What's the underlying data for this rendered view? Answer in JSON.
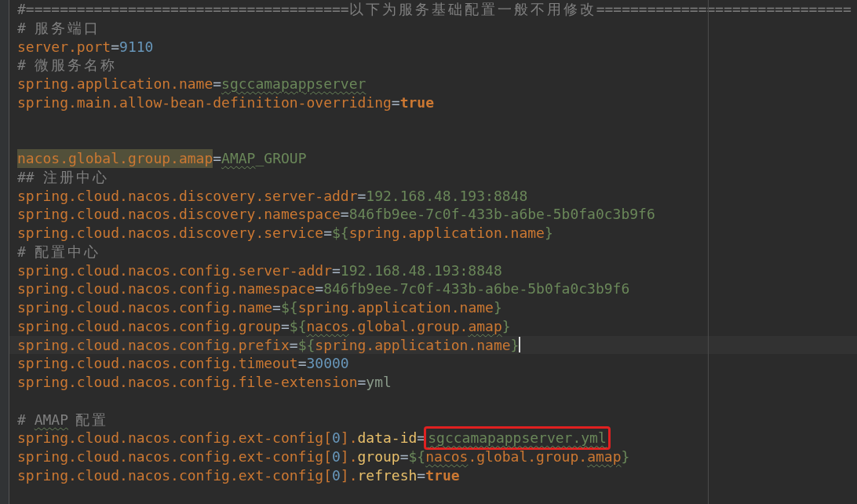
{
  "editor": {
    "lines": [
      {
        "kind": "code",
        "current": false,
        "segments": [
          {
            "text": "#======================================",
            "kind": "comment"
          },
          {
            "text": "以下为服务基础配置一般不用修改",
            "kind": "comment-cn"
          },
          {
            "text": "==============================",
            "kind": "comment"
          }
        ]
      },
      {
        "kind": "code",
        "current": false,
        "segments": [
          {
            "text": "# ",
            "kind": "comment"
          },
          {
            "text": "服务端口",
            "kind": "comment-cn"
          }
        ]
      },
      {
        "kind": "code",
        "current": false,
        "segments": [
          {
            "text": "server.port",
            "kind": "key"
          },
          {
            "text": "=",
            "kind": "sep"
          },
          {
            "text": "9110",
            "kind": "number"
          }
        ]
      },
      {
        "kind": "code",
        "current": false,
        "segments": [
          {
            "text": "# ",
            "kind": "comment"
          },
          {
            "text": "微服务名称",
            "kind": "comment-cn"
          }
        ]
      },
      {
        "kind": "code",
        "current": false,
        "segments": [
          {
            "text": "spring.application.name",
            "kind": "key"
          },
          {
            "text": "=",
            "kind": "sep"
          },
          {
            "text": "sgccamapappserver",
            "kind": "string-typo"
          }
        ]
      },
      {
        "kind": "code",
        "current": false,
        "segments": [
          {
            "text": "spring.main.allow-bean-definition-overriding",
            "kind": "key"
          },
          {
            "text": "=",
            "kind": "sep"
          },
          {
            "text": "true",
            "kind": "bool"
          }
        ]
      },
      {
        "kind": "blank"
      },
      {
        "kind": "blank"
      },
      {
        "kind": "code",
        "current": false,
        "segments": [
          {
            "text": "nacos.global.group.amap",
            "kind": "key-found"
          },
          {
            "text": "=",
            "kind": "sep"
          },
          {
            "text": "AMAP",
            "kind": "string-typo"
          },
          {
            "text": "_GROUP",
            "kind": "string"
          }
        ]
      },
      {
        "kind": "code",
        "current": false,
        "segments": [
          {
            "text": "## ",
            "kind": "comment"
          },
          {
            "text": "注册中心",
            "kind": "comment-cn"
          }
        ]
      },
      {
        "kind": "code",
        "current": false,
        "segments": [
          {
            "text": "spring.cloud.nacos.discovery.server-addr",
            "kind": "key"
          },
          {
            "text": "=",
            "kind": "sep"
          },
          {
            "text": "192.168.48.193:8848",
            "kind": "string"
          }
        ]
      },
      {
        "kind": "code",
        "current": false,
        "segments": [
          {
            "text": "spring.cloud.nacos.discovery.namespace",
            "kind": "key"
          },
          {
            "text": "=",
            "kind": "sep"
          },
          {
            "text": "846fb9ee-7c0f-433b-a6be-5b0fa0c3b9f6",
            "kind": "string"
          }
        ]
      },
      {
        "kind": "code",
        "current": false,
        "segments": [
          {
            "text": "spring.cloud.nacos.discovery.service",
            "kind": "key"
          },
          {
            "text": "=",
            "kind": "sep"
          },
          {
            "text": "${",
            "kind": "brace"
          },
          {
            "text": "spring.application.name",
            "kind": "ref"
          },
          {
            "text": "}",
            "kind": "brace"
          }
        ]
      },
      {
        "kind": "code",
        "current": false,
        "segments": [
          {
            "text": "# ",
            "kind": "comment"
          },
          {
            "text": "配置中心",
            "kind": "comment-cn"
          }
        ]
      },
      {
        "kind": "code",
        "current": false,
        "segments": [
          {
            "text": "spring.cloud.nacos.config.server-addr",
            "kind": "key"
          },
          {
            "text": "=",
            "kind": "sep"
          },
          {
            "text": "192.168.48.193:8848",
            "kind": "string"
          }
        ]
      },
      {
        "kind": "code",
        "current": false,
        "segments": [
          {
            "text": "spring.cloud.nacos.config.namespace",
            "kind": "key"
          },
          {
            "text": "=",
            "kind": "sep"
          },
          {
            "text": "846fb9ee-7c0f-433b-a6be-5b0fa0c3b9f6",
            "kind": "string"
          }
        ]
      },
      {
        "kind": "code",
        "current": false,
        "segments": [
          {
            "text": "spring.cloud.nacos.config.name",
            "kind": "key"
          },
          {
            "text": "=",
            "kind": "sep"
          },
          {
            "text": "${",
            "kind": "brace"
          },
          {
            "text": "spring.application.name",
            "kind": "ref"
          },
          {
            "text": "}",
            "kind": "brace"
          }
        ]
      },
      {
        "kind": "code",
        "current": false,
        "segments": [
          {
            "text": "spring.cloud.nacos.config.group",
            "kind": "key"
          },
          {
            "text": "=",
            "kind": "sep"
          },
          {
            "text": "${",
            "kind": "brace"
          },
          {
            "text": "nacos",
            "kind": "ref-typo"
          },
          {
            "text": ".global.group.",
            "kind": "ref"
          },
          {
            "text": "amap",
            "kind": "ref-typo"
          },
          {
            "text": "}",
            "kind": "brace"
          }
        ]
      },
      {
        "kind": "code",
        "current": true,
        "segments": [
          {
            "text": "spring.cloud.nacos.config.prefix",
            "kind": "key"
          },
          {
            "text": "=",
            "kind": "sep"
          },
          {
            "text": "${",
            "kind": "brace"
          },
          {
            "text": "spring.application.name",
            "kind": "ref"
          },
          {
            "text": "}",
            "kind": "brace"
          }
        ]
      },
      {
        "kind": "code",
        "current": false,
        "segments": [
          {
            "text": "spring.cloud.nacos.config.timeout",
            "kind": "key"
          },
          {
            "text": "=",
            "kind": "sep"
          },
          {
            "text": "30000",
            "kind": "number"
          }
        ]
      },
      {
        "kind": "code",
        "current": false,
        "segments": [
          {
            "text": "spring.cloud.nacos.config.file-extension",
            "kind": "key"
          },
          {
            "text": "=",
            "kind": "sep"
          },
          {
            "text": "yml",
            "kind": "plain"
          }
        ]
      },
      {
        "kind": "blank"
      },
      {
        "kind": "code",
        "current": false,
        "segments": [
          {
            "text": "# ",
            "kind": "comment"
          },
          {
            "text": "AMAP",
            "kind": "comment-typo"
          },
          {
            "text": " 配置",
            "kind": "comment-cn"
          }
        ]
      },
      {
        "kind": "code",
        "current": false,
        "segments": [
          {
            "text": "spring.cloud.nacos.config.ext-config[",
            "kind": "key"
          },
          {
            "text": "0",
            "kind": "index"
          },
          {
            "text": "].",
            "kind": "key"
          },
          {
            "text": "data-id",
            "kind": "key-sub"
          },
          {
            "text": "=",
            "kind": "sep"
          },
          {
            "text": "sgccamapappserver.yml",
            "kind": "string-boxed"
          }
        ]
      },
      {
        "kind": "code",
        "current": false,
        "segments": [
          {
            "text": "spring.cloud.nacos.config.ext-config[",
            "kind": "key"
          },
          {
            "text": "0",
            "kind": "index"
          },
          {
            "text": "].",
            "kind": "key"
          },
          {
            "text": "group",
            "kind": "key-sub"
          },
          {
            "text": "=",
            "kind": "sep"
          },
          {
            "text": "${",
            "kind": "brace"
          },
          {
            "text": "nacos",
            "kind": "ref-typo"
          },
          {
            "text": ".global.group.",
            "kind": "ref"
          },
          {
            "text": "amap",
            "kind": "ref-typo"
          },
          {
            "text": "}",
            "kind": "brace"
          }
        ]
      },
      {
        "kind": "code",
        "current": false,
        "segments": [
          {
            "text": "spring.cloud.nacos.config.ext-config[",
            "kind": "key"
          },
          {
            "text": "0",
            "kind": "index"
          },
          {
            "text": "].",
            "kind": "key"
          },
          {
            "text": "refresh",
            "kind": "key-sub"
          },
          {
            "text": "=",
            "kind": "sep"
          },
          {
            "text": "true",
            "kind": "bool"
          }
        ]
      }
    ]
  }
}
